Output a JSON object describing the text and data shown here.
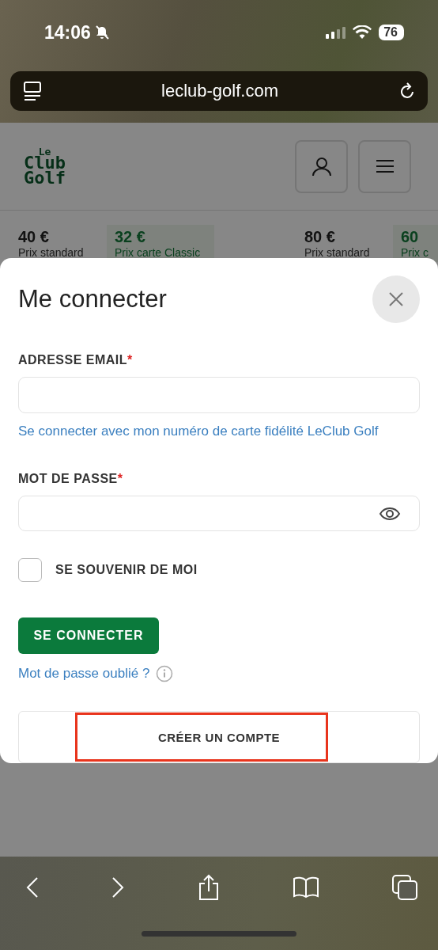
{
  "status_bar": {
    "time": "14:06",
    "silent": true,
    "battery": "76"
  },
  "address_bar": {
    "url": "leclub-golf.com"
  },
  "site_header": {
    "logo": [
      "Le",
      "Club",
      "Golf"
    ]
  },
  "prices": [
    {
      "amount": "40 €",
      "label": "Prix standard",
      "kind": "standard"
    },
    {
      "amount": "32 €",
      "label": "Prix carte Classic",
      "kind": "member"
    },
    {
      "amount": "80 €",
      "label": "Prix standard",
      "kind": "standard"
    },
    {
      "amount": "60",
      "label": "Prix c",
      "kind": "member"
    }
  ],
  "login_sheet": {
    "title": "Me connecter",
    "email": {
      "label": "ADRESSE EMAIL",
      "required_mark": "*"
    },
    "card_link": "Se connecter avec mon numéro de carte fidélité LeClub Golf",
    "password": {
      "label": "MOT DE PASSE",
      "required_mark": "*"
    },
    "remember": {
      "label": "SE SOUVENIR DE MOI",
      "checked": false
    },
    "submit": "SE CONNECTER",
    "forgot_link": "Mot de passe oublié ?",
    "create_account": {
      "label": "CRÉER UN COMPTE",
      "highlighted": true
    }
  }
}
